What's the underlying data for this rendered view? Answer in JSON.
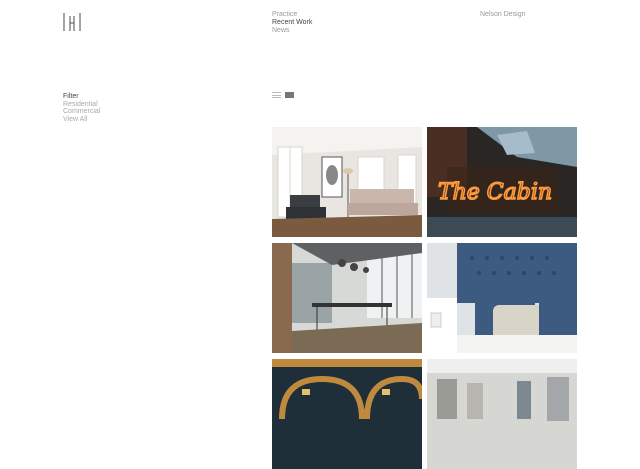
{
  "nav": {
    "items": [
      {
        "label": "Practice",
        "active": false
      },
      {
        "label": "Recent Work",
        "active": true
      },
      {
        "label": "News",
        "active": false
      }
    ]
  },
  "brand": "Nelson Design",
  "filter": {
    "title": "Filter",
    "options": [
      "Residential",
      "Commercial",
      "View All"
    ]
  },
  "neon_sign_text": "The Cabin",
  "colors": {
    "text_active": "#444444",
    "text_muted": "#999999"
  }
}
